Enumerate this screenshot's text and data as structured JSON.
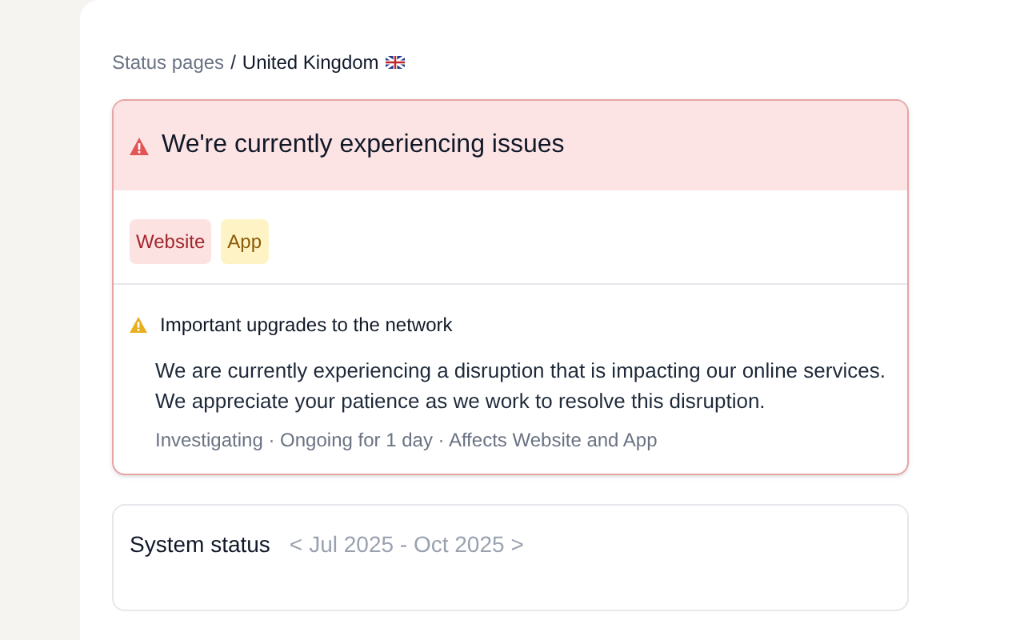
{
  "breadcrumb": {
    "parent": "Status pages",
    "separator": "/",
    "current": "United Kingdom"
  },
  "status_banner": {
    "title": "We're currently experiencing issues",
    "kind": "error"
  },
  "affected_components": [
    {
      "label": "Website",
      "color": "#fde2e2"
    },
    {
      "label": "App",
      "color": "#fdf3c4"
    }
  ],
  "incident": {
    "title": "Important upgrades to the network",
    "kind": "warning",
    "description": "We are currently experiencing a disruption that is impacting our online services. We appreciate your patience as we work to resolve this disruption.",
    "meta": "Investigating · Ongoing for 1 day · Affects Website and App"
  },
  "system_status": {
    "title": "System status",
    "prev": "<",
    "range": "Jul 2025 - Oct 2025",
    "next": ">"
  }
}
